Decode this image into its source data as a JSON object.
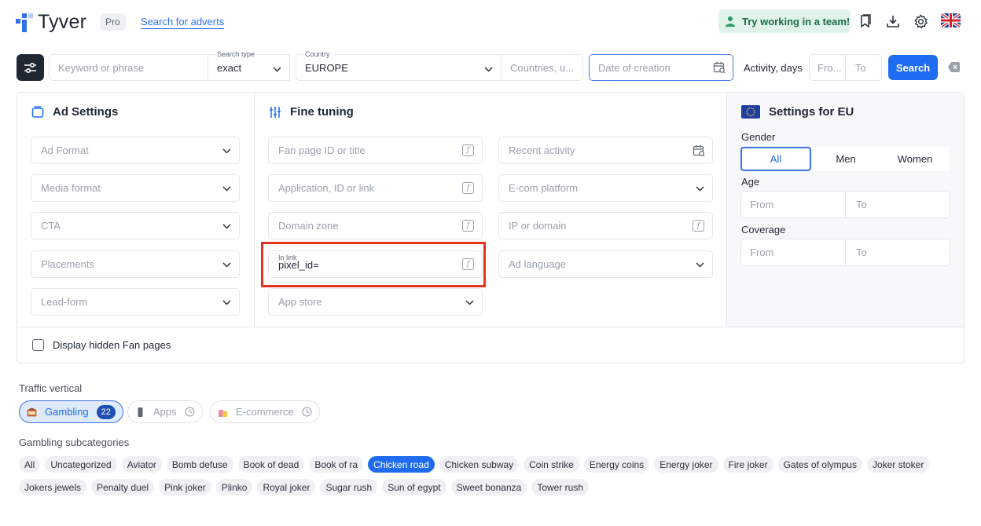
{
  "header": {
    "brand": "Tyver",
    "plan_badge": "Pro",
    "search_link": "Search for adverts",
    "team_button": "Try working in a team!",
    "icons": [
      "bookmark-icon",
      "download-icon",
      "gear-icon",
      "uk-flag-icon"
    ]
  },
  "filter_bar": {
    "keyword_placeholder": "Keyword or phrase",
    "search_type_label": "Search type",
    "search_type_value": "exact",
    "country_label": "Country",
    "country_value": "EUROPE",
    "countries_placeholder": "Countries, u...",
    "date_placeholder": "Date of creation",
    "activity_label": "Activity, days",
    "activity_from": "Fro...",
    "activity_to": "To",
    "search_button": "Search"
  },
  "ad_settings": {
    "title": "Ad Settings",
    "fields": [
      "Ad Format",
      "Media format",
      "CTA",
      "Placements",
      "Lead-form"
    ]
  },
  "fine_tuning": {
    "title": "Fine tuning",
    "fan_page": "Fan page ID or title",
    "application": "Application, ID or link",
    "domain_zone": "Domain zone",
    "in_link_label": "In link",
    "in_link_value": "pixel_id=",
    "app_store": "App store",
    "recent_activity": "Recent activity",
    "ecom_platform": "E-com platform",
    "ip_domain": "IP or domain",
    "ad_language": "Ad language"
  },
  "eu_settings": {
    "title": "Settings for EU",
    "gender_label": "Gender",
    "gender_options": [
      "All",
      "Men",
      "Women"
    ],
    "gender_selected": "All",
    "age_label": "Age",
    "age_from": "From",
    "age_to": "To",
    "coverage_label": "Coverage",
    "coverage_from": "From",
    "coverage_to": "To"
  },
  "hidden_fan_pages": "Display hidden Fan pages",
  "traffic_vertical": {
    "heading": "Traffic vertical",
    "items": [
      {
        "label": "Gambling",
        "count": "22",
        "active": true
      },
      {
        "label": "Apps",
        "active": false
      },
      {
        "label": "E-commerce",
        "active": false
      }
    ]
  },
  "subcategories": {
    "heading": "Gambling subcategories",
    "row1": [
      "All",
      "Uncategorized",
      "Aviator",
      "Bomb defuse",
      "Book of dead",
      "Book of ra",
      "Chicken road",
      "Chicken subway",
      "Coin strike",
      "Energy coins",
      "Energy joker",
      "Fire joker",
      "Gates of olympus",
      "Joker stoker"
    ],
    "row2": [
      "Jokers jewels",
      "Penalty duel",
      "Pink joker",
      "Plinko",
      "Royal joker",
      "Sugar rush",
      "Sun of egypt",
      "Sweet bonanza",
      "Tower rush"
    ],
    "selected": "Chicken road"
  },
  "colors": {
    "accent": "#1f6cf0",
    "highlight": "#e8321e",
    "team_bg": "#dff3e9"
  }
}
